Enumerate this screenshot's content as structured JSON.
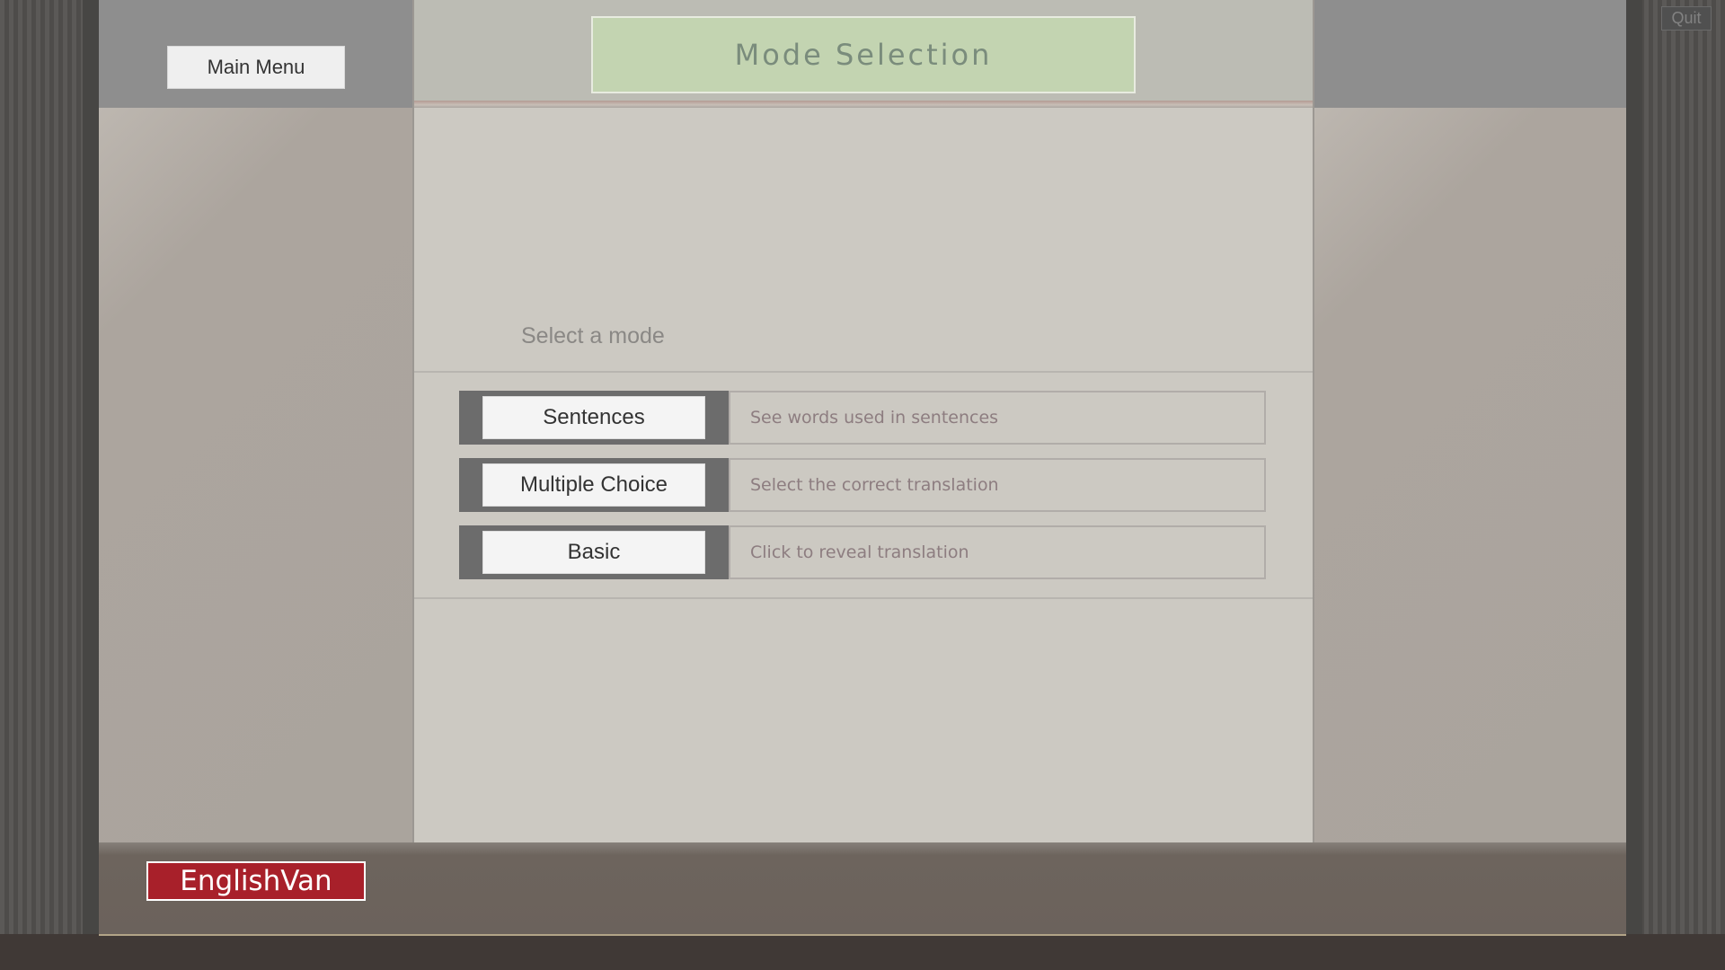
{
  "header": {
    "title": "Mode Selection",
    "main_menu_label": "Main Menu",
    "quit_label": "Quit"
  },
  "content": {
    "prompt": "Select a mode",
    "modes": [
      {
        "label": "Sentences",
        "description": "See words used in sentences"
      },
      {
        "label": "Multiple Choice",
        "description": "Select the correct translation"
      },
      {
        "label": "Basic",
        "description": "Click to reveal translation"
      }
    ]
  },
  "footer": {
    "logo_text": "EnglishVan"
  },
  "colors": {
    "title_bg": "#c3d4b1",
    "logo_bg": "#a8202a",
    "panel_bg": "#ccc9c2"
  }
}
